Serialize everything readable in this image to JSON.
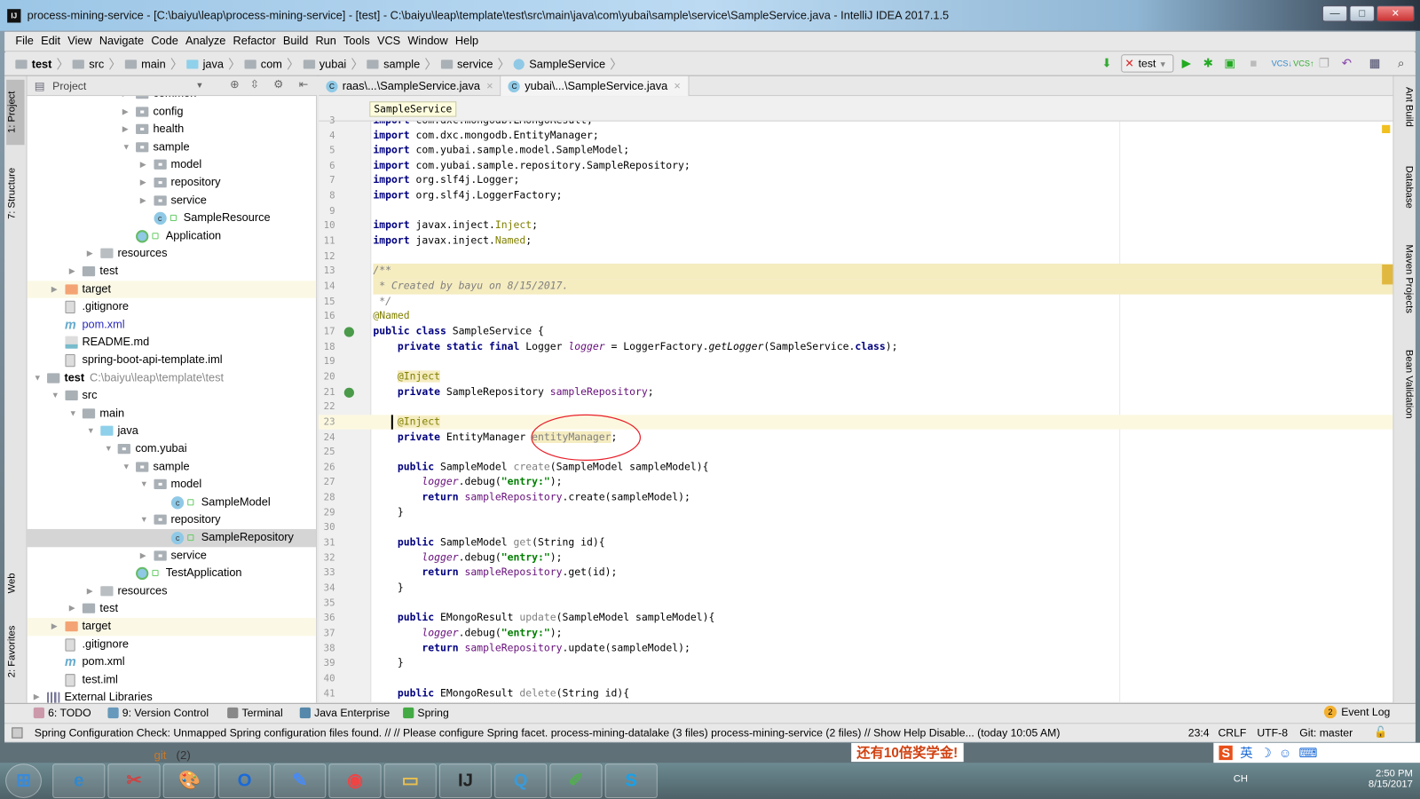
{
  "window": {
    "title": "process-mining-service - [C:\\baiyu\\leap\\process-mining-service] - [test] - C:\\baiyu\\leap\\template\\test\\src\\main\\java\\com\\yubai\\sample\\service\\SampleService.java - IntelliJ IDEA 2017.1.5",
    "app_icon": "IJ"
  },
  "menu": [
    "File",
    "Edit",
    "View",
    "Navigate",
    "Code",
    "Analyze",
    "Refactor",
    "Build",
    "Run",
    "Tools",
    "VCS",
    "Window",
    "Help"
  ],
  "navbar": {
    "crumbs": [
      "test",
      "src",
      "main",
      "java",
      "com",
      "yubai",
      "sample",
      "service",
      "SampleService"
    ],
    "run_config": "test"
  },
  "left_strip": {
    "project": "1: Project",
    "structure": "7: Structure",
    "web": "Web",
    "favorites": "2: Favorites"
  },
  "right_strip": {
    "ant": "Ant Build",
    "database": "Database",
    "maven": "Maven Projects",
    "bean": "Bean Validation"
  },
  "project_panel": {
    "title": "Project",
    "tree": [
      {
        "label": "common",
        "depth": 5,
        "arrow": "right",
        "icon": "pkg"
      },
      {
        "label": "config",
        "depth": 5,
        "arrow": "right",
        "icon": "pkg"
      },
      {
        "label": "health",
        "depth": 5,
        "arrow": "right",
        "icon": "pkg"
      },
      {
        "label": "sample",
        "depth": 5,
        "arrow": "down",
        "icon": "pkg"
      },
      {
        "label": "model",
        "depth": 6,
        "arrow": "right",
        "icon": "pkg"
      },
      {
        "label": "repository",
        "depth": 6,
        "arrow": "right",
        "icon": "pkg"
      },
      {
        "label": "service",
        "depth": 6,
        "arrow": "right",
        "icon": "pkg"
      },
      {
        "label": "SampleResource",
        "depth": 6,
        "arrow": "",
        "icon": "class",
        "lock": true
      },
      {
        "label": "Application",
        "depth": 5,
        "arrow": "",
        "icon": "app",
        "lock": true
      },
      {
        "label": "resources",
        "depth": 3,
        "arrow": "right",
        "icon": "res"
      },
      {
        "label": "test",
        "depth": 2,
        "arrow": "right",
        "icon": "folder"
      },
      {
        "label": "target",
        "depth": 1,
        "arrow": "right",
        "icon": "target",
        "state": "hl"
      },
      {
        "label": ".gitignore",
        "depth": 1,
        "arrow": "",
        "icon": "file"
      },
      {
        "label": "pom.xml",
        "depth": 1,
        "arrow": "",
        "icon": "maven",
        "color": "#2b2bbf"
      },
      {
        "label": "README.md",
        "depth": 1,
        "arrow": "",
        "icon": "md"
      },
      {
        "label": "spring-boot-api-template.iml",
        "depth": 1,
        "arrow": "",
        "icon": "file"
      },
      {
        "label": "test",
        "depth": 0,
        "arrow": "down",
        "icon": "folder",
        "bold": true,
        "path": "C:\\baiyu\\leap\\template\\test"
      },
      {
        "label": "src",
        "depth": 1,
        "arrow": "down",
        "icon": "folder"
      },
      {
        "label": "main",
        "depth": 2,
        "arrow": "down",
        "icon": "folder"
      },
      {
        "label": "java",
        "depth": 3,
        "arrow": "down",
        "icon": "src"
      },
      {
        "label": "com.yubai",
        "depth": 4,
        "arrow": "down",
        "icon": "pkg"
      },
      {
        "label": "sample",
        "depth": 5,
        "arrow": "down",
        "icon": "pkg"
      },
      {
        "label": "model",
        "depth": 6,
        "arrow": "down",
        "icon": "pkg"
      },
      {
        "label": "SampleModel",
        "depth": 7,
        "arrow": "",
        "icon": "class",
        "lock": true
      },
      {
        "label": "repository",
        "depth": 6,
        "arrow": "down",
        "icon": "pkg"
      },
      {
        "label": "SampleRepository",
        "depth": 7,
        "arrow": "",
        "icon": "class",
        "lock": true,
        "state": "sel"
      },
      {
        "label": "service",
        "depth": 6,
        "arrow": "right",
        "icon": "pkg"
      },
      {
        "label": "TestApplication",
        "depth": 5,
        "arrow": "",
        "icon": "app",
        "lock": true
      },
      {
        "label": "resources",
        "depth": 3,
        "arrow": "right",
        "icon": "res"
      },
      {
        "label": "test",
        "depth": 2,
        "arrow": "right",
        "icon": "folder"
      },
      {
        "label": "target",
        "depth": 1,
        "arrow": "right",
        "icon": "target",
        "state": "hl"
      },
      {
        "label": ".gitignore",
        "depth": 1,
        "arrow": "",
        "icon": "file"
      },
      {
        "label": "pom.xml",
        "depth": 1,
        "arrow": "",
        "icon": "maven"
      },
      {
        "label": "test.iml",
        "depth": 1,
        "arrow": "",
        "icon": "file"
      },
      {
        "label": "External Libraries",
        "depth": 0,
        "arrow": "right",
        "icon": "lib"
      }
    ]
  },
  "editor": {
    "tabs": [
      {
        "label": "raas\\...\\SampleService.java",
        "active": false
      },
      {
        "label": "yubai\\...\\SampleService.java",
        "active": true
      }
    ],
    "breadcrumb": "SampleService",
    "current_line": 23,
    "lines": [
      {
        "n": 3,
        "t": [
          [
            "kw",
            "import "
          ],
          [
            "p",
            "com.dxc.mongodb.EMongoResult;"
          ]
        ]
      },
      {
        "n": 4,
        "t": [
          [
            "kw",
            "import "
          ],
          [
            "p",
            "com.dxc.mongodb.EntityManager;"
          ]
        ]
      },
      {
        "n": 5,
        "t": [
          [
            "kw",
            "import "
          ],
          [
            "p",
            "com.yubai.sample.model.SampleModel;"
          ]
        ]
      },
      {
        "n": 6,
        "t": [
          [
            "kw",
            "import "
          ],
          [
            "p",
            "com.yubai.sample.repository.SampleRepository;"
          ]
        ]
      },
      {
        "n": 7,
        "t": [
          [
            "kw",
            "import "
          ],
          [
            "p",
            "org.slf4j.Logger;"
          ]
        ]
      },
      {
        "n": 8,
        "t": [
          [
            "kw",
            "import "
          ],
          [
            "p",
            "org.slf4j.LoggerFactory;"
          ]
        ]
      },
      {
        "n": 9,
        "t": []
      },
      {
        "n": 10,
        "t": [
          [
            "kw",
            "import "
          ],
          [
            "p",
            "javax.inject."
          ],
          [
            "ann",
            "Inject"
          ],
          [
            "p",
            ";"
          ]
        ]
      },
      {
        "n": 11,
        "t": [
          [
            "kw",
            "import "
          ],
          [
            "p",
            "javax.inject."
          ],
          [
            "ann",
            "Named"
          ],
          [
            "p",
            ";"
          ]
        ]
      },
      {
        "n": 12,
        "t": []
      },
      {
        "n": 13,
        "t": [
          [
            "cmt",
            "/**"
          ]
        ],
        "bg": "comment"
      },
      {
        "n": 14,
        "t": [
          [
            "cmt",
            " * Created by bayu on 8/15/2017."
          ]
        ],
        "bg": "comment"
      },
      {
        "n": 15,
        "t": [
          [
            "cmt",
            " */"
          ]
        ]
      },
      {
        "n": 16,
        "t": [
          [
            "ann",
            "@Named"
          ]
        ]
      },
      {
        "n": 17,
        "t": [
          [
            "kw",
            "public class "
          ],
          [
            "p",
            "SampleService {"
          ]
        ],
        "gutter": "bean"
      },
      {
        "n": 18,
        "t": [
          [
            "p",
            "    "
          ],
          [
            "kw",
            "private static final "
          ],
          [
            "p",
            "Logger "
          ],
          [
            "sfld",
            "logger"
          ],
          [
            "p",
            " = LoggerFactory."
          ],
          [
            "i",
            "getLogger"
          ],
          [
            "p",
            "(SampleService."
          ],
          [
            "kw",
            "class"
          ],
          [
            "p",
            ");"
          ]
        ]
      },
      {
        "n": 19,
        "t": []
      },
      {
        "n": 20,
        "t": [
          [
            "p",
            "    "
          ],
          [
            "ann anbg",
            "@Inject"
          ]
        ]
      },
      {
        "n": 21,
        "t": [
          [
            "p",
            "    "
          ],
          [
            "kw",
            "private "
          ],
          [
            "p",
            "SampleRepository "
          ],
          [
            "fld",
            "sampleRepository"
          ],
          [
            "p",
            ";"
          ]
        ],
        "gutter": "bean"
      },
      {
        "n": 22,
        "t": []
      },
      {
        "n": 23,
        "t": [
          [
            "p",
            "    "
          ],
          [
            "ann anbg",
            "@Inject"
          ]
        ]
      },
      {
        "n": 24,
        "t": [
          [
            "p",
            "    "
          ],
          [
            "kw",
            "private "
          ],
          [
            "p",
            "EntityManager "
          ],
          [
            "unu anbg",
            "entityManager"
          ],
          [
            "p",
            ";"
          ]
        ]
      },
      {
        "n": 25,
        "t": []
      },
      {
        "n": 26,
        "t": [
          [
            "p",
            "    "
          ],
          [
            "kw",
            "public "
          ],
          [
            "p",
            "SampleModel "
          ],
          [
            "unu",
            "create"
          ],
          [
            "p",
            "(SampleModel sampleModel){"
          ]
        ]
      },
      {
        "n": 27,
        "t": [
          [
            "p",
            "        "
          ],
          [
            "sfld",
            "logger"
          ],
          [
            "p",
            ".debug("
          ],
          [
            "str",
            "\"entry:\""
          ],
          [
            "p",
            ");"
          ]
        ]
      },
      {
        "n": 28,
        "t": [
          [
            "p",
            "        "
          ],
          [
            "kw",
            "return "
          ],
          [
            "fld",
            "sampleRepository"
          ],
          [
            "p",
            ".create(sampleModel);"
          ]
        ]
      },
      {
        "n": 29,
        "t": [
          [
            "p",
            "    }"
          ]
        ]
      },
      {
        "n": 30,
        "t": []
      },
      {
        "n": 31,
        "t": [
          [
            "p",
            "    "
          ],
          [
            "kw",
            "public "
          ],
          [
            "p",
            "SampleModel "
          ],
          [
            "unu",
            "get"
          ],
          [
            "p",
            "(String id){"
          ]
        ]
      },
      {
        "n": 32,
        "t": [
          [
            "p",
            "        "
          ],
          [
            "sfld",
            "logger"
          ],
          [
            "p",
            ".debug("
          ],
          [
            "str",
            "\"entry:\""
          ],
          [
            "p",
            ");"
          ]
        ]
      },
      {
        "n": 33,
        "t": [
          [
            "p",
            "        "
          ],
          [
            "kw",
            "return "
          ],
          [
            "fld",
            "sampleRepository"
          ],
          [
            "p",
            ".get(id);"
          ]
        ]
      },
      {
        "n": 34,
        "t": [
          [
            "p",
            "    }"
          ]
        ]
      },
      {
        "n": 35,
        "t": []
      },
      {
        "n": 36,
        "t": [
          [
            "p",
            "    "
          ],
          [
            "kw",
            "public "
          ],
          [
            "p",
            "EMongoResult "
          ],
          [
            "unu",
            "update"
          ],
          [
            "p",
            "(SampleModel sampleModel){"
          ]
        ]
      },
      {
        "n": 37,
        "t": [
          [
            "p",
            "        "
          ],
          [
            "sfld",
            "logger"
          ],
          [
            "p",
            ".debug("
          ],
          [
            "str",
            "\"entry:\""
          ],
          [
            "p",
            ");"
          ]
        ]
      },
      {
        "n": 38,
        "t": [
          [
            "p",
            "        "
          ],
          [
            "kw",
            "return "
          ],
          [
            "fld",
            "sampleRepository"
          ],
          [
            "p",
            ".update(sampleModel);"
          ]
        ]
      },
      {
        "n": 39,
        "t": [
          [
            "p",
            "    }"
          ]
        ]
      },
      {
        "n": 40,
        "t": []
      },
      {
        "n": 41,
        "t": [
          [
            "p",
            "    "
          ],
          [
            "kw",
            "public "
          ],
          [
            "p",
            "EMongoResult "
          ],
          [
            "unu",
            "delete"
          ],
          [
            "p",
            "(String id){"
          ]
        ]
      }
    ]
  },
  "bottom_tools": [
    {
      "label": "6: TODO",
      "icon": "todo-icon"
    },
    {
      "label": "9: Version Control",
      "icon": "vcs-icon"
    },
    {
      "label": "Terminal",
      "icon": "terminal-icon"
    },
    {
      "label": "Java Enterprise",
      "icon": "java-enterprise-icon"
    },
    {
      "label": "Spring",
      "icon": "spring-icon"
    }
  ],
  "event_log": {
    "label": "Event Log",
    "count": "2"
  },
  "status": {
    "message": "Spring Configuration Check: Unmapped Spring configuration files found. // // Please configure Spring facet. process-mining-datalake (3 files) process-mining-service (2 files) // Show Help Disable... (today 10:05 AM)",
    "position": "23:4",
    "line_sep": "CRLF",
    "encoding": "UTF-8",
    "vcs": "Git: master"
  },
  "desktop": {
    "git_label": "git",
    "git_count": "(2)",
    "ad_text": "还有10倍奖学金!"
  },
  "taskbar": {
    "apps": [
      "start",
      "internet-explorer",
      "snipping-tool",
      "paint",
      "outlook",
      "notes",
      "chrome",
      "explorer",
      "intellij",
      "qq",
      "notepad",
      "skype"
    ],
    "lang": "CH",
    "ime": "英",
    "time": "2:50 PM",
    "date": "8/15/2017"
  },
  "colors": {
    "keyword": "#000080",
    "annotation": "#808000",
    "string": "#008000",
    "field": "#660e7a",
    "comment": "#808080",
    "annotation_circle": "#e8202a"
  }
}
